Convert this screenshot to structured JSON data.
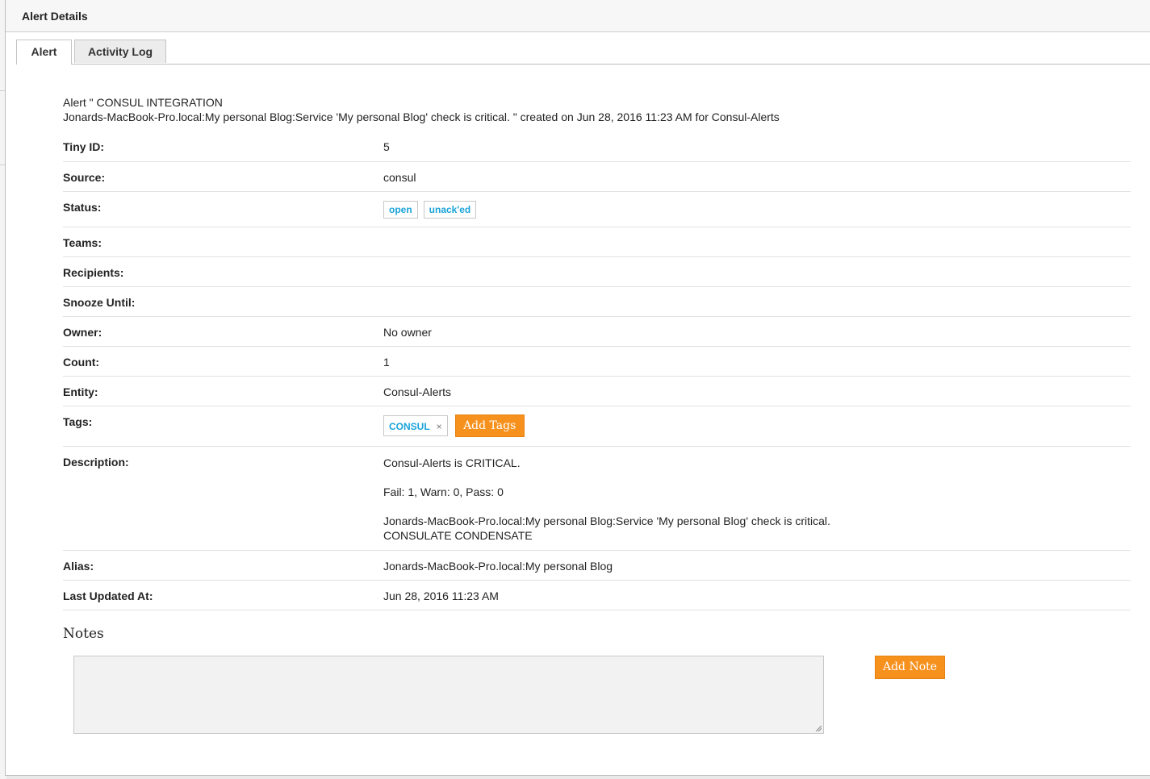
{
  "dialog": {
    "title": "Alert Details"
  },
  "tabs": [
    {
      "label": "Alert",
      "active": true
    },
    {
      "label": "Activity Log",
      "active": false
    }
  ],
  "summary": {
    "line1": "Alert \" CONSUL INTEGRATION",
    "line2": "Jonards-MacBook-Pro.local:My personal Blog:Service 'My personal Blog' check is critical. \" created on Jun 28, 2016 11:23 AM for Consul-Alerts"
  },
  "fields": {
    "tiny_id": {
      "label": "Tiny ID:",
      "value": "5"
    },
    "source": {
      "label": "Source:",
      "value": "consul"
    },
    "status": {
      "label": "Status:",
      "badges": [
        "open",
        "unack'ed"
      ]
    },
    "teams": {
      "label": "Teams:",
      "value": ""
    },
    "recipients": {
      "label": "Recipients:",
      "value": ""
    },
    "snooze": {
      "label": "Snooze Until:",
      "value": ""
    },
    "owner": {
      "label": "Owner:",
      "value": "No owner"
    },
    "count": {
      "label": "Count:",
      "value": "1"
    },
    "entity": {
      "label": "Entity:",
      "value": "Consul-Alerts"
    },
    "tags": {
      "label": "Tags:",
      "tag": "CONSUL",
      "remove_glyph": "×",
      "add_label": "Add Tags"
    },
    "description": {
      "label": "Description:",
      "lines": [
        "Consul-Alerts is CRITICAL.",
        "Fail: 1, Warn: 0, Pass: 0",
        "Jonards-MacBook-Pro.local:My personal Blog:Service 'My personal Blog' check is critical.",
        "CONSULATE CONDENSATE"
      ]
    },
    "alias": {
      "label": "Alias:",
      "value": "Jonards-MacBook-Pro.local:My personal Blog"
    },
    "last_updated": {
      "label": "Last Updated At:",
      "value": "Jun 28, 2016 11:23 AM"
    }
  },
  "notes": {
    "title": "Notes",
    "placeholder": "",
    "add_label": "Add Note"
  },
  "colors": {
    "accent_orange": "#f7911e",
    "link_blue": "#1aa3d9"
  }
}
